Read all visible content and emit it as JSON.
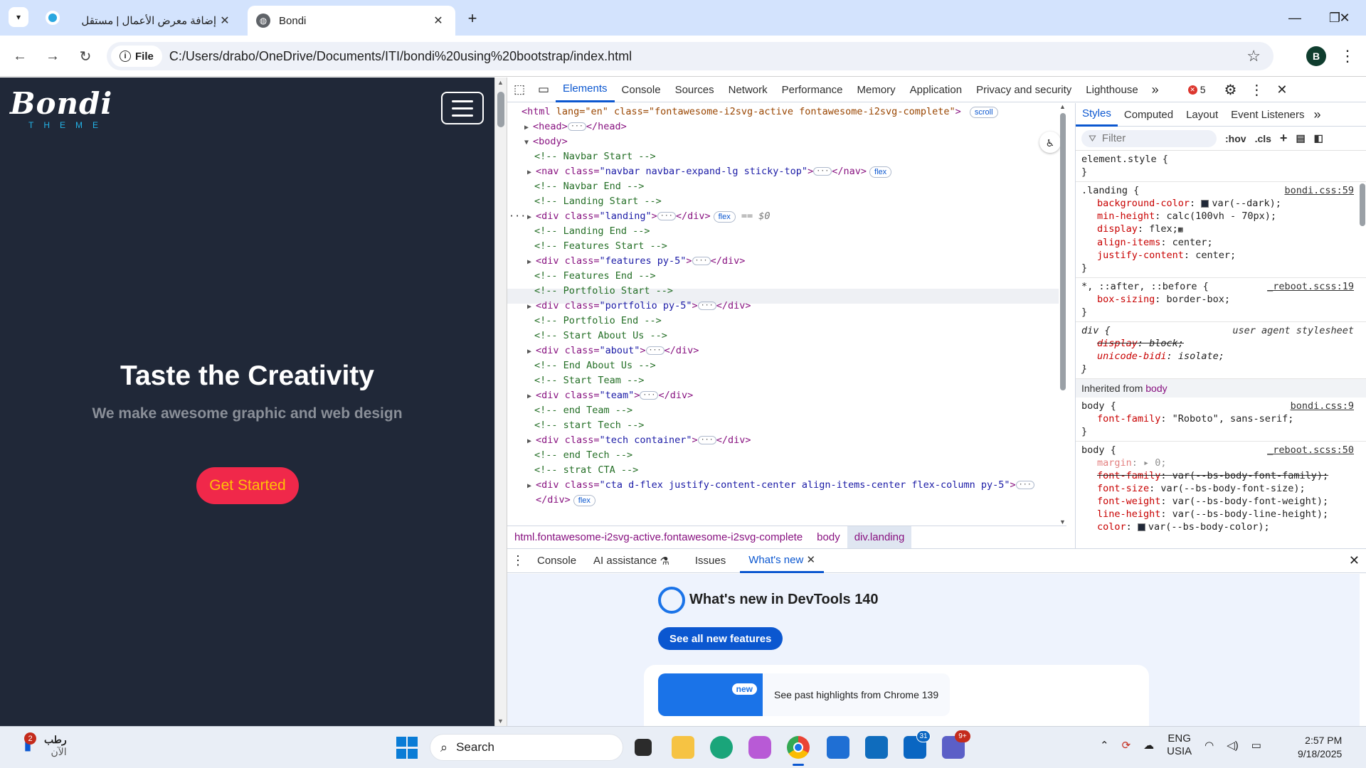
{
  "browser": {
    "tabs": [
      {
        "title": "إضافة معرض الأعمال | مستقل",
        "active": false
      },
      {
        "title": "Bondi",
        "active": true
      }
    ],
    "address": {
      "chip_label": "File",
      "url": "C:/Users/drabo/OneDrive/Documents/ITI/bondi%20using%20bootstrap/index.html"
    },
    "profile_initial": "B"
  },
  "page": {
    "logo": "Bondi",
    "logo_sub": "THEME",
    "hero_title": "Taste the Creativity",
    "hero_subtitle": "We make awesome graphic and web design",
    "cta_label": "Get Started",
    "colors": {
      "background": "#202838",
      "cta": "#f0284a",
      "cta_text": "#ffc107"
    }
  },
  "devtools": {
    "tabs": [
      "Elements",
      "Console",
      "Sources",
      "Network",
      "Performance",
      "Memory",
      "Application",
      "Privacy and security",
      "Lighthouse"
    ],
    "active_tab": "Elements",
    "error_count": "5",
    "dom": {
      "html_line": {
        "tag": "html",
        "attrs": "lang=\"en\" class=\"fontawesome-i2svg-active fontawesome-i2svg-complete\"",
        "badge": "scroll"
      },
      "head": "<head>",
      "head_close": "</head>",
      "body": "<body>",
      "lines": [
        {
          "kind": "comment",
          "text": "<!-- Navbar Start -->"
        },
        {
          "kind": "element",
          "open": "<nav class=",
          "cls": "\"navbar navbar-expand-lg sticky-top\"",
          "close": "</nav>",
          "badge": "flex"
        },
        {
          "kind": "comment",
          "text": "<!-- Navbar End -->"
        },
        {
          "kind": "comment",
          "text": "<!-- Landing Start -->"
        },
        {
          "kind": "element",
          "open": "<div class=",
          "cls": "\"landing\"",
          "close": "</div>",
          "badge": "flex",
          "selected": "== $0"
        },
        {
          "kind": "comment",
          "text": "<!-- Landing End -->"
        },
        {
          "kind": "comment",
          "text": "<!-- Features Start -->"
        },
        {
          "kind": "element",
          "open": "<div class=",
          "cls": "\"features py-5\"",
          "close": "</div>",
          "badge": ""
        },
        {
          "kind": "comment",
          "text": "<!-- Features End -->"
        },
        {
          "kind": "comment",
          "text": "<!-- Portfolio Start -->"
        },
        {
          "kind": "element",
          "open": "<div class=",
          "cls": "\"portfolio py-5\"",
          "close": "</div>",
          "badge": ""
        },
        {
          "kind": "comment",
          "text": "<!-- Portfolio End -->"
        },
        {
          "kind": "comment",
          "text": "<!-- Start About Us -->"
        },
        {
          "kind": "element",
          "open": "<div class=",
          "cls": "\"about\"",
          "close": "</div>",
          "badge": ""
        },
        {
          "kind": "comment",
          "text": "<!-- End About Us -->"
        },
        {
          "kind": "comment",
          "text": "<!-- Start Team -->"
        },
        {
          "kind": "element",
          "open": "<div class=",
          "cls": "\"team\"",
          "close": "</div>",
          "badge": ""
        },
        {
          "kind": "comment",
          "text": "<!-- end Team -->"
        },
        {
          "kind": "comment",
          "text": "<!-- start Tech -->"
        },
        {
          "kind": "element",
          "open": "<div class=",
          "cls": "\"tech container\"",
          "close": "</div>",
          "badge": ""
        },
        {
          "kind": "comment",
          "text": "<!-- end Tech -->"
        },
        {
          "kind": "comment",
          "text": "<!-- strat CTA -->"
        },
        {
          "kind": "element",
          "open": "<div class=",
          "cls": "\"cta d-flex justify-content-center align-items-center flex-column py-5\"",
          "close": "",
          "badge": ""
        },
        {
          "kind": "close",
          "text": "</div>",
          "badge": "flex"
        }
      ]
    },
    "breadcrumb": [
      "html.fontawesome-i2svg-active.fontawesome-i2svg-complete",
      "body",
      "div.landing"
    ],
    "styles": {
      "tabs": [
        "Styles",
        "Computed",
        "Layout",
        "Event Listeners"
      ],
      "filter_placeholder": "Filter",
      "hov": ":hov",
      "cls": ".cls",
      "rules": {
        "element_style": "element.style {",
        "landing": {
          "selector": ".landing {",
          "source": "bondi.css:59",
          "decls": [
            {
              "p": "background-color",
              "v": "var(--dark);"
            },
            {
              "p": "min-height",
              "v": "calc(100vh - 70px);"
            },
            {
              "p": "display",
              "v": "flex;"
            },
            {
              "p": "align-items",
              "v": "center;"
            },
            {
              "p": "justify-content",
              "v": "center;"
            }
          ]
        },
        "star": {
          "selector": "*, ::after, ::before {",
          "source": "_reboot.scss:19",
          "decls": [
            {
              "p": "box-sizing",
              "v": "border-box;"
            }
          ]
        },
        "div": {
          "selector": "div {",
          "source": "user agent stylesheet",
          "decls": [
            {
              "p": "display",
              "v": "block;"
            },
            {
              "p": "unicode-bidi",
              "v": "isolate;"
            }
          ]
        },
        "inherited": {
          "label": "Inherited from",
          "from": "body"
        },
        "body1": {
          "selector": "body {",
          "source": "bondi.css:9",
          "decls": [
            {
              "p": "font-family",
              "v": "\"Roboto\", sans-serif;"
            }
          ]
        },
        "body2": {
          "selector": "body {",
          "source": "_reboot.scss:50",
          "decls": [
            {
              "p": "margin",
              "v": "0;"
            },
            {
              "p": "font-family",
              "v": "var(--bs-body-font-family);"
            },
            {
              "p": "font-size",
              "v": "var(--bs-body-font-size);"
            },
            {
              "p": "font-weight",
              "v": "var(--bs-body-font-weight);"
            },
            {
              "p": "line-height",
              "v": "var(--bs-body-line-height);"
            },
            {
              "p": "color",
              "v": "var(--bs-body-color);"
            }
          ]
        },
        "close": "}"
      }
    },
    "drawer": {
      "tabs": [
        "Console",
        "AI assistance",
        "Issues",
        "What's new"
      ],
      "active_tab": "What's new",
      "title": "What's new in DevTools 140",
      "button": "See all new features",
      "highlight_badge": "new",
      "highlight_text": "See past highlights from Chrome 139"
    }
  },
  "taskbar": {
    "weather_label": "رطب",
    "weather_time": "الآن",
    "weather_badge": "2",
    "search_label": "Search",
    "lang": "ENG",
    "region": "USIA",
    "time": "2:57 PM",
    "date": "9/18/2025",
    "linkedin_badge": "31",
    "teams_badge": "9+"
  }
}
